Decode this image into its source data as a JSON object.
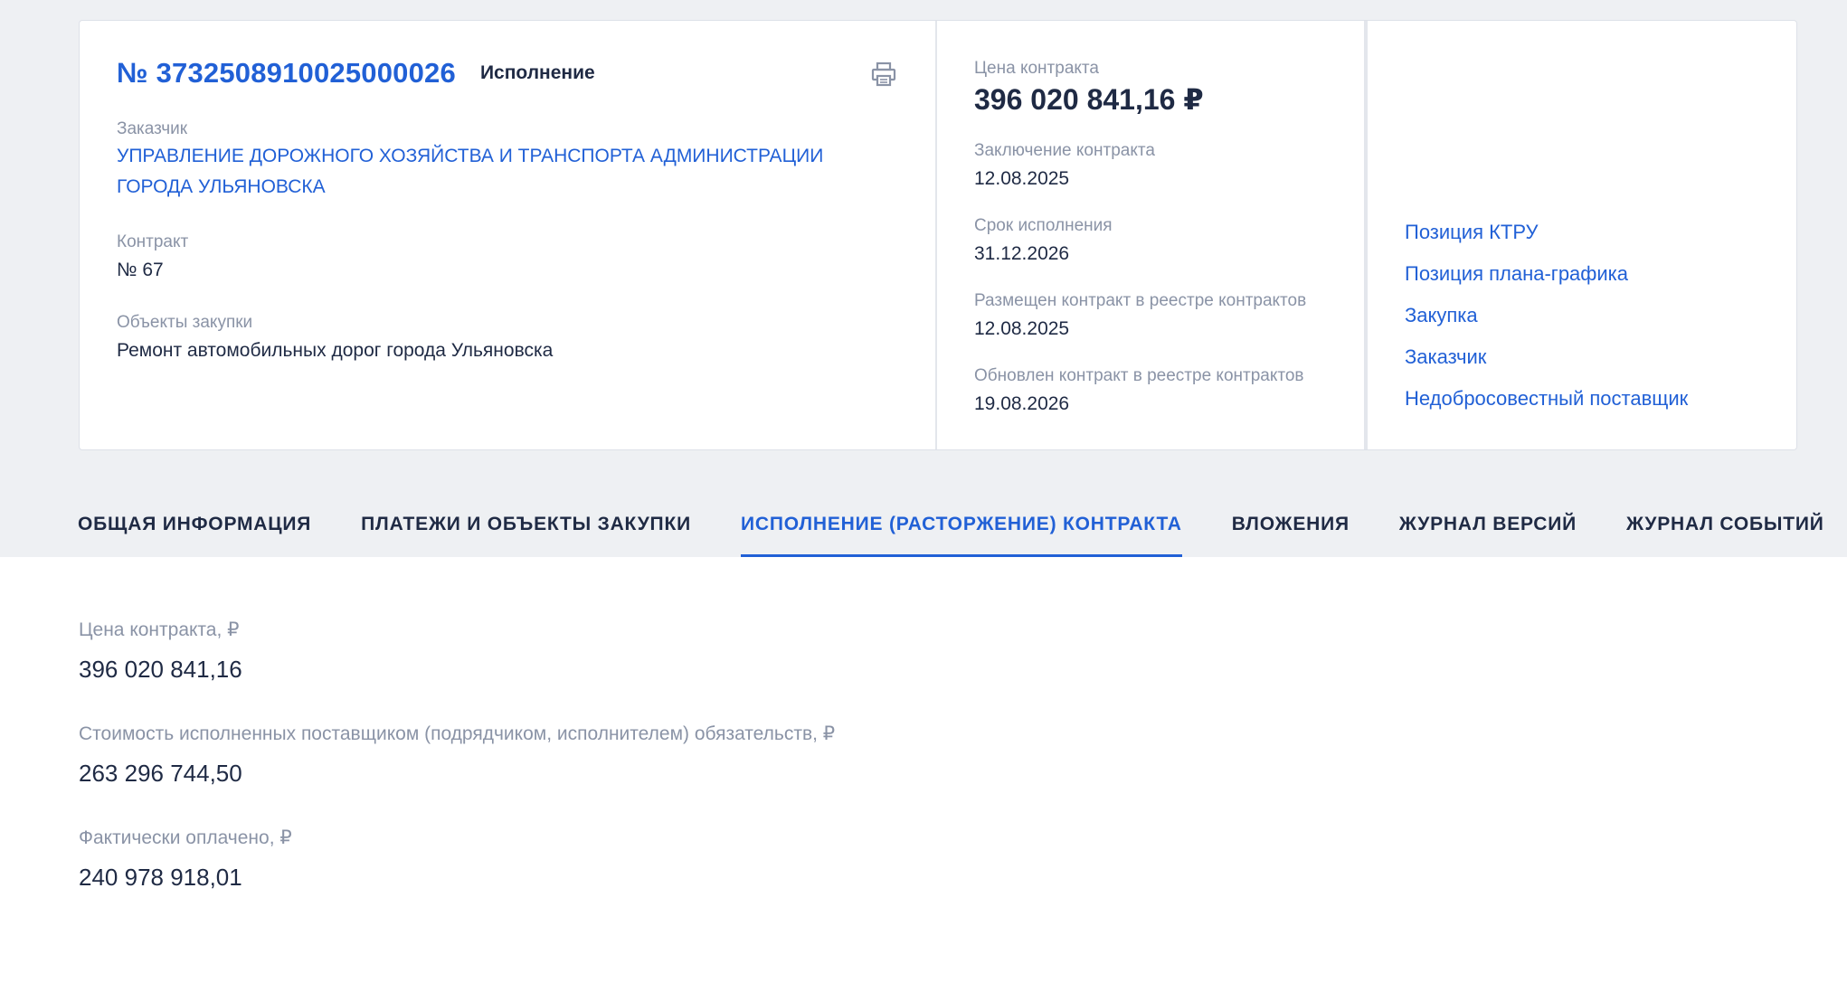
{
  "header": {
    "contract_number": "№ 3732508910025000026",
    "status": "Исполнение"
  },
  "left": {
    "customer_label": "Заказчик",
    "customer_name": "УПРАВЛЕНИЕ ДОРОЖНОГО ХОЗЯЙСТВА И ТРАНСПОРТА АДМИНИСТРАЦИИ ГОРОДА УЛЬЯНОВСКА",
    "contract_label": "Контракт",
    "contract_value": "№ 67",
    "objects_label": "Объекты закупки",
    "objects_value": "Ремонт автомобильных дорог города Ульяновска"
  },
  "middle": {
    "price_label": "Цена контракта",
    "price_value": "396 020 841,16 ₽",
    "conclusion_label": "Заключение контракта",
    "conclusion_value": "12.08.2025",
    "term_label": "Срок исполнения",
    "term_value": "31.12.2026",
    "placed_label": "Размещен контракт в реестре контрактов",
    "placed_value": "12.08.2025",
    "updated_label": "Обновлен контракт в реестре контрактов",
    "updated_value": "19.08.2026"
  },
  "links": [
    "Позиция КТРУ",
    "Позиция плана-графика",
    "Закупка",
    "Заказчик",
    "Недобросовестный поставщик"
  ],
  "tabs": [
    "ОБЩАЯ ИНФОРМАЦИЯ",
    "ПЛАТЕЖИ И ОБЪЕКТЫ ЗАКУПКИ",
    "ИСПОЛНЕНИЕ (РАСТОРЖЕНИЕ) КОНТРАКТА",
    "ВЛОЖЕНИЯ",
    "ЖУРНАЛ ВЕРСИЙ",
    "ЖУРНАЛ СОБЫТИЙ"
  ],
  "details": {
    "price_label": "Цена контракта, ₽",
    "price_value": "396 020 841,16",
    "executed_label": "Стоимость исполненных поставщиком (подрядчиком, исполнителем) обязательств, ₽",
    "executed_value": "263 296 744,50",
    "paid_label": "Фактически оплачено, ₽",
    "paid_value": "240 978 918,01"
  },
  "colors": {
    "accent": "#2160d6",
    "muted": "#8a93a6",
    "text": "#1f2a44",
    "page_bg": "#eef0f3"
  },
  "icons": {
    "print": "printer-icon"
  }
}
